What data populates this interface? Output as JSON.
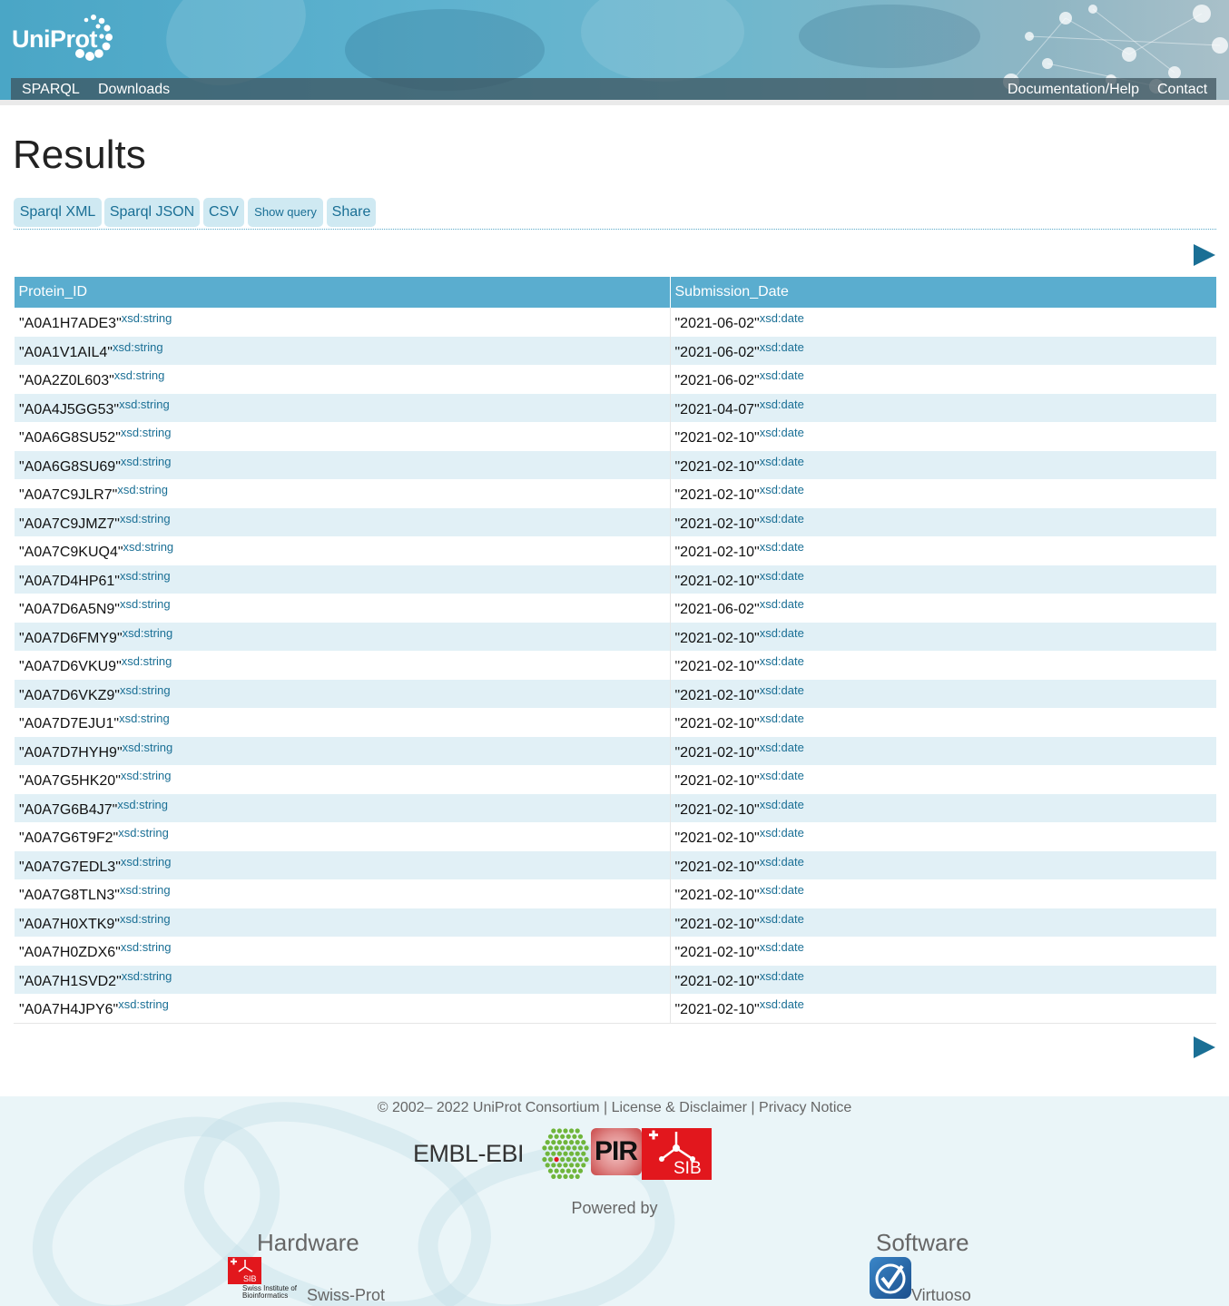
{
  "header": {
    "logo_text": "UniProt",
    "nav_left": [
      "SPARQL",
      "Downloads"
    ],
    "nav_right": [
      "Documentation/Help",
      "Contact"
    ]
  },
  "page": {
    "title": "Results"
  },
  "buttons": {
    "sparql_xml": "Sparql XML",
    "sparql_json": "Sparql JSON",
    "csv": "CSV",
    "show_query": "Show query",
    "share": "Share"
  },
  "table": {
    "columns": [
      "Protein_ID",
      "Submission_Date"
    ],
    "rows": [
      {
        "id": "\"A0A1H7ADE3\"",
        "id_type": "xsd:string",
        "date": "\"2021-06-02\"",
        "date_type": "xsd:date"
      },
      {
        "id": "\"A0A1V1AIL4\"",
        "id_type": "xsd:string",
        "date": "\"2021-06-02\"",
        "date_type": "xsd:date"
      },
      {
        "id": "\"A0A2Z0L603\"",
        "id_type": "xsd:string",
        "date": "\"2021-06-02\"",
        "date_type": "xsd:date"
      },
      {
        "id": "\"A0A4J5GG53\"",
        "id_type": "xsd:string",
        "date": "\"2021-04-07\"",
        "date_type": "xsd:date"
      },
      {
        "id": "\"A0A6G8SU52\"",
        "id_type": "xsd:string",
        "date": "\"2021-02-10\"",
        "date_type": "xsd:date"
      },
      {
        "id": "\"A0A6G8SU69\"",
        "id_type": "xsd:string",
        "date": "\"2021-02-10\"",
        "date_type": "xsd:date"
      },
      {
        "id": "\"A0A7C9JLR7\"",
        "id_type": "xsd:string",
        "date": "\"2021-02-10\"",
        "date_type": "xsd:date"
      },
      {
        "id": "\"A0A7C9JMZ7\"",
        "id_type": "xsd:string",
        "date": "\"2021-02-10\"",
        "date_type": "xsd:date"
      },
      {
        "id": "\"A0A7C9KUQ4\"",
        "id_type": "xsd:string",
        "date": "\"2021-02-10\"",
        "date_type": "xsd:date"
      },
      {
        "id": "\"A0A7D4HP61\"",
        "id_type": "xsd:string",
        "date": "\"2021-02-10\"",
        "date_type": "xsd:date"
      },
      {
        "id": "\"A0A7D6A5N9\"",
        "id_type": "xsd:string",
        "date": "\"2021-06-02\"",
        "date_type": "xsd:date"
      },
      {
        "id": "\"A0A7D6FMY9\"",
        "id_type": "xsd:string",
        "date": "\"2021-02-10\"",
        "date_type": "xsd:date"
      },
      {
        "id": "\"A0A7D6VKU9\"",
        "id_type": "xsd:string",
        "date": "\"2021-02-10\"",
        "date_type": "xsd:date"
      },
      {
        "id": "\"A0A7D6VKZ9\"",
        "id_type": "xsd:string",
        "date": "\"2021-02-10\"",
        "date_type": "xsd:date"
      },
      {
        "id": "\"A0A7D7EJU1\"",
        "id_type": "xsd:string",
        "date": "\"2021-02-10\"",
        "date_type": "xsd:date"
      },
      {
        "id": "\"A0A7D7HYH9\"",
        "id_type": "xsd:string",
        "date": "\"2021-02-10\"",
        "date_type": "xsd:date"
      },
      {
        "id": "\"A0A7G5HK20\"",
        "id_type": "xsd:string",
        "date": "\"2021-02-10\"",
        "date_type": "xsd:date"
      },
      {
        "id": "\"A0A7G6B4J7\"",
        "id_type": "xsd:string",
        "date": "\"2021-02-10\"",
        "date_type": "xsd:date"
      },
      {
        "id": "\"A0A7G6T9F2\"",
        "id_type": "xsd:string",
        "date": "\"2021-02-10\"",
        "date_type": "xsd:date"
      },
      {
        "id": "\"A0A7G7EDL3\"",
        "id_type": "xsd:string",
        "date": "\"2021-02-10\"",
        "date_type": "xsd:date"
      },
      {
        "id": "\"A0A7G8TLN3\"",
        "id_type": "xsd:string",
        "date": "\"2021-02-10\"",
        "date_type": "xsd:date"
      },
      {
        "id": "\"A0A7H0XTK9\"",
        "id_type": "xsd:string",
        "date": "\"2021-02-10\"",
        "date_type": "xsd:date"
      },
      {
        "id": "\"A0A7H0ZDX6\"",
        "id_type": "xsd:string",
        "date": "\"2021-02-10\"",
        "date_type": "xsd:date"
      },
      {
        "id": "\"A0A7H1SVD2\"",
        "id_type": "xsd:string",
        "date": "\"2021-02-10\"",
        "date_type": "xsd:date"
      },
      {
        "id": "\"A0A7H4JPY6\"",
        "id_type": "xsd:string",
        "date": "\"2021-02-10\"",
        "date_type": "xsd:date"
      }
    ]
  },
  "icons": {
    "next_page": "play-triangle-icon"
  },
  "colors": {
    "accent": "#1a6f95",
    "header_bg": "#5aadcf",
    "row_alt": "#e1f0f6",
    "button_bg": "#cfe9f2"
  },
  "footer": {
    "copyright": "© 2002– 2022 UniProt Consortium",
    "sep": "|",
    "license": "License & Disclaimer",
    "privacy": "Privacy Notice",
    "embl_ebi": "EMBL-EBI",
    "pir": "PIR",
    "sib": "SIB",
    "powered_by": "Powered by",
    "hardware_title": "Hardware",
    "hardware_link": "Swiss-Prot",
    "sib_caption_1": "Swiss Institute of",
    "sib_caption_2": "Bioinformatics",
    "software_title": "Software",
    "software_link": "Virtuoso"
  }
}
